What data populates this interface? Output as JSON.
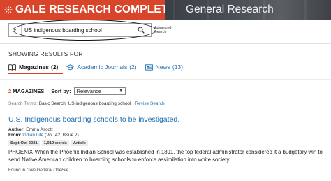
{
  "header": {
    "brand": "GALE RESEARCH COMPLETE",
    "product": "General Research",
    "brand_color": "#d9452b"
  },
  "search": {
    "query": "US indigenous boarding school",
    "advanced_line1": "Advanced",
    "advanced_line2": "Search"
  },
  "showing_results_for": "SHOWING RESULTS FOR",
  "tabs": [
    {
      "label": "Magazines",
      "count": "(2)",
      "icon": "book-icon",
      "active": true
    },
    {
      "label": "Academic Journals",
      "count": "(2)",
      "icon": "mortarboard-icon",
      "active": false
    },
    {
      "label": "News",
      "count": "(13)",
      "icon": "newspaper-icon",
      "active": false
    }
  ],
  "results": {
    "count": "2",
    "type_label": "MAGAZINES",
    "sort_label": "Sort by:",
    "sort_value": "Relevance",
    "search_terms_label": "Search Terms:",
    "search_terms_value": "Basic Search: US indigenous boarding school",
    "revise_label": "Revise Search"
  },
  "item": {
    "title": "U.S. Indigenous boarding schools to be investigated.",
    "author_label": "Author:",
    "author": "Emma Ascott",
    "from_label": "From:",
    "source": "Indian Life",
    "source_detail": "(Vol. 42, Issue 2)",
    "badges": [
      "Sept-Oct 2021",
      "1,019 words",
      "Article"
    ],
    "abstract": "PHOENIX-When the Phoenix Indian School was established in 1891, the top federal administrator considered it a budgetary win to send Native American children to boarding schools to enforce assimilation into white society....",
    "found_in_label": "Found in",
    "found_in": "Gale General OneFile"
  },
  "link_color": "#1f6fb2"
}
